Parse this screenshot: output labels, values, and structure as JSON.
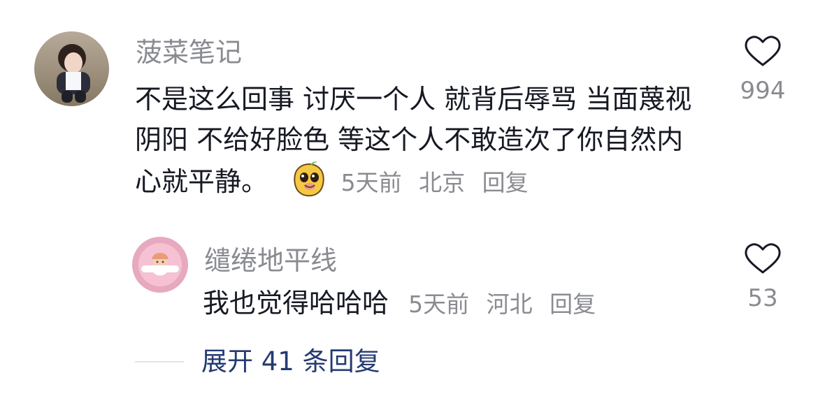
{
  "comments": [
    {
      "username": "菠菜笔记",
      "text": "不是这么回事 讨厌一个人 就背后辱骂 当面蔑视 阴阳 不给好脸色 等这个人不敢造次了你自然内心就平静。",
      "sticker_icon": "mango-emoji-sticker",
      "time": "5天前",
      "location": "北京",
      "reply_label": "回复",
      "likes": "994"
    },
    {
      "username": "缱绻地平线",
      "text": "我也觉得哈哈哈",
      "time": "5天前",
      "location": "河北",
      "reply_label": "回复",
      "likes": "53"
    }
  ],
  "expand": {
    "label": "展开 41 条回复"
  },
  "colors": {
    "username": "#8a8b91",
    "text": "#161823",
    "link": "#243a72",
    "divider": "#e4e4e6"
  }
}
